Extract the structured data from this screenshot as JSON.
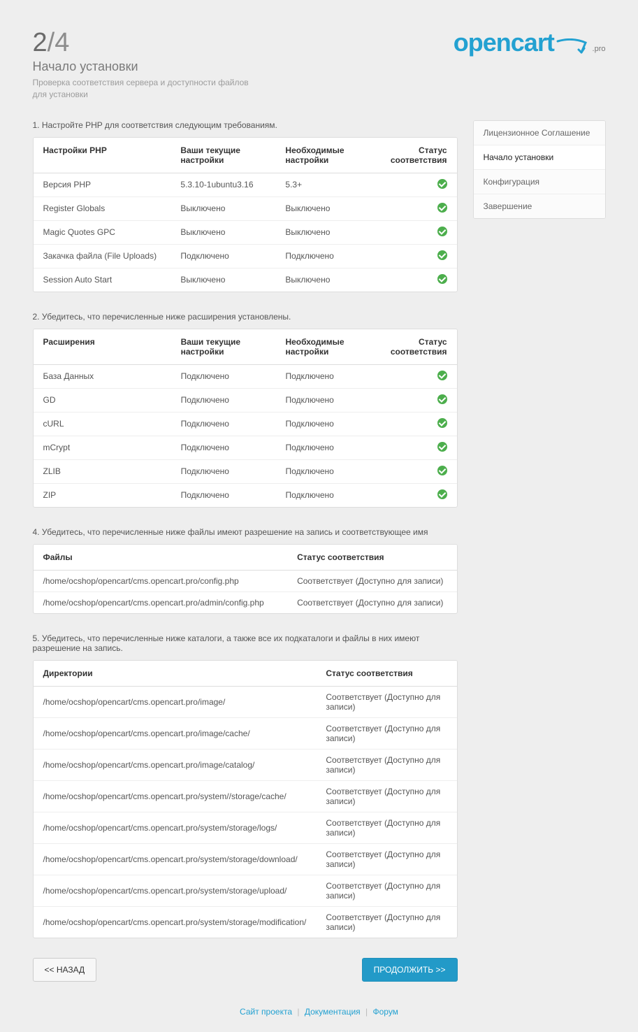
{
  "header": {
    "step_current": "2",
    "step_total": "/4",
    "title": "Начало установки",
    "subtitle": "Проверка соответствия сервера и доступности файлов для установки",
    "logo_main": "opencart",
    "logo_sub": ".pro"
  },
  "sidebar": {
    "items": [
      {
        "label": "Лицензионное Соглашение",
        "active": false
      },
      {
        "label": "Начало установки",
        "active": true
      },
      {
        "label": "Конфигурация",
        "active": false
      },
      {
        "label": "Завершение",
        "active": false
      }
    ]
  },
  "sections": {
    "s1": {
      "lead": "1. Настройте PHP для соответствия следующим требованиям.",
      "head": [
        "Настройки PHP",
        "Ваши текущие настройки",
        "Необходимые настройки",
        "Статус соответствия"
      ],
      "rows": [
        [
          "Версия PHP",
          "5.3.10-1ubuntu3.16",
          "5.3+",
          "ok"
        ],
        [
          "Register Globals",
          "Выключено",
          "Выключено",
          "ok"
        ],
        [
          "Magic Quotes GPC",
          "Выключено",
          "Выключено",
          "ok"
        ],
        [
          "Закачка файла (File Uploads)",
          "Подключено",
          "Подключено",
          "ok"
        ],
        [
          "Session Auto Start",
          "Выключено",
          "Выключено",
          "ok"
        ]
      ]
    },
    "s2": {
      "lead": "2. Убедитесь, что перечисленные ниже расширения установлены.",
      "head": [
        "Расширения",
        "Ваши текущие настройки",
        "Необходимые настройки",
        "Статус соответствия"
      ],
      "rows": [
        [
          "База Данных",
          "Подключено",
          "Подключено",
          "ok"
        ],
        [
          "GD",
          "Подключено",
          "Подключено",
          "ok"
        ],
        [
          "cURL",
          "Подключено",
          "Подключено",
          "ok"
        ],
        [
          "mCrypt",
          "Подключено",
          "Подключено",
          "ok"
        ],
        [
          "ZLIB",
          "Подключено",
          "Подключено",
          "ok"
        ],
        [
          "ZIP",
          "Подключено",
          "Подключено",
          "ok"
        ]
      ]
    },
    "s4": {
      "lead": "4. Убедитесь, что перечисленные ниже файлы имеют разрешение на запись и соответствующее имя",
      "head": [
        "Файлы",
        "Статус соответствия"
      ],
      "rows": [
        [
          "/home/ocshop/opencart/cms.opencart.pro/config.php",
          "Соответствует (Доступно для записи)"
        ],
        [
          "/home/ocshop/opencart/cms.opencart.pro/admin/config.php",
          "Соответствует (Доступно для записи)"
        ]
      ]
    },
    "s5": {
      "lead": "5. Убедитесь, что перечисленные ниже каталоги, а также все их подкаталоги и файлы в них имеют разрешение на запись.",
      "head": [
        "Директории",
        "Статус соответствия"
      ],
      "rows": [
        [
          "/home/ocshop/opencart/cms.opencart.pro/image/",
          "Соответствует (Доступно для записи)"
        ],
        [
          "/home/ocshop/opencart/cms.opencart.pro/image/cache/",
          "Соответствует (Доступно для записи)"
        ],
        [
          "/home/ocshop/opencart/cms.opencart.pro/image/catalog/",
          "Соответствует (Доступно для записи)"
        ],
        [
          "/home/ocshop/opencart/cms.opencart.pro/system//storage/cache/",
          "Соответствует (Доступно для записи)"
        ],
        [
          "/home/ocshop/opencart/cms.opencart.pro/system/storage/logs/",
          "Соответствует (Доступно для записи)"
        ],
        [
          "/home/ocshop/opencart/cms.opencart.pro/system/storage/download/",
          "Соответствует (Доступно для записи)"
        ],
        [
          "/home/ocshop/opencart/cms.opencart.pro/system/storage/upload/",
          "Соответствует (Доступно для записи)"
        ],
        [
          "/home/ocshop/opencart/cms.opencart.pro/system/storage/modification/",
          "Соответствует (Доступно для записи)"
        ]
      ]
    }
  },
  "buttons": {
    "back": "<< НАЗАД",
    "next": "ПРОДОЛЖИТЬ >>"
  },
  "footer": {
    "links": [
      "Сайт проекта",
      "Документация",
      "Форум"
    ]
  }
}
